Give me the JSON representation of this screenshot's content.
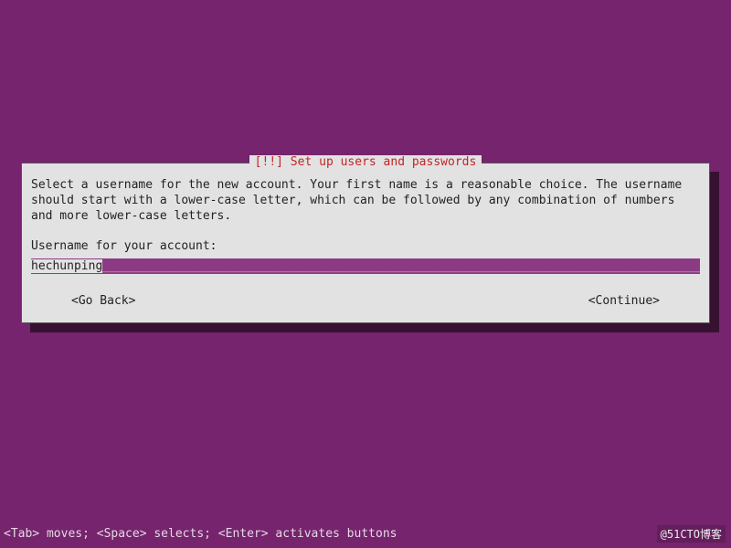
{
  "dialog": {
    "title": "[!!] Set up users and passwords",
    "prompt": "Select a username for the new account. Your first name is a reasonable choice. The username should start with a lower-case letter, which can be followed by any combination of numbers and more lower-case letters.",
    "field_label": "Username for your account:",
    "input_value": "hechunping",
    "go_back_label": "<Go Back>",
    "continue_label": "<Continue>"
  },
  "footer": {
    "help_text": "<Tab> moves; <Space> selects; <Enter> activates buttons"
  },
  "watermark": "@51CTO博客",
  "colors": {
    "background": "#75246d",
    "input_bg": "#8d3a84",
    "dialog_bg": "#e2e2e2",
    "title_fg": "#c22525"
  }
}
